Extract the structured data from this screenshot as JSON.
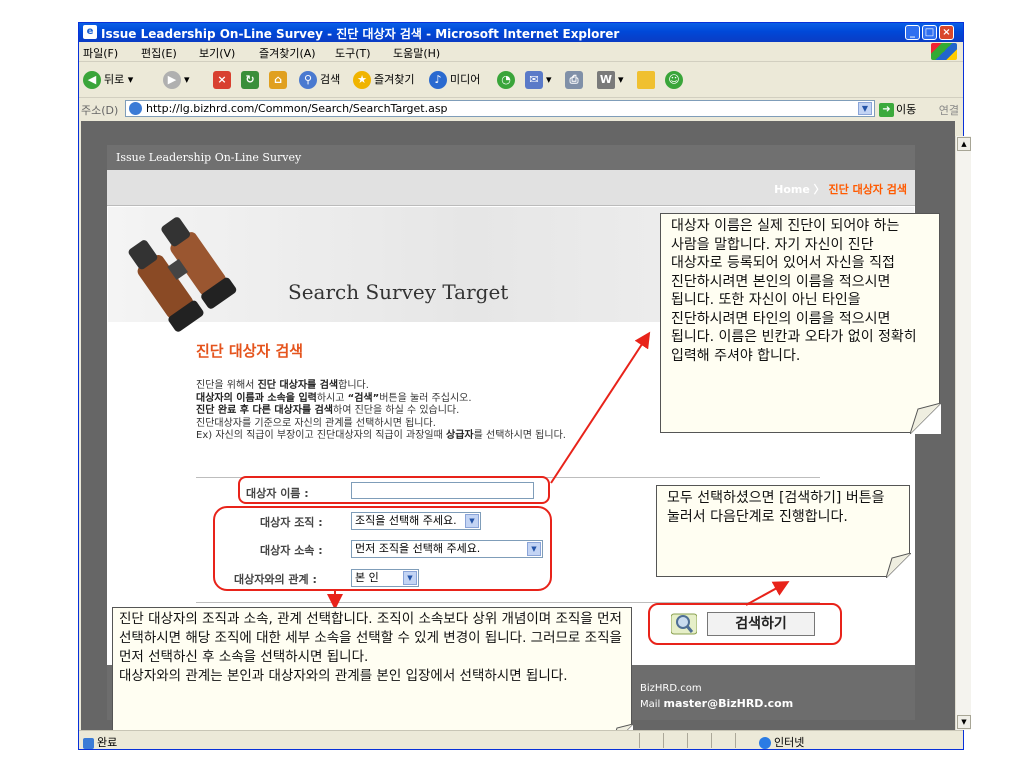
{
  "window": {
    "title": "Issue Leadership On-Line Survey - 진단 대상자 검색 - Microsoft Internet Explorer",
    "controls": {
      "minimize": "_",
      "maximize": "□",
      "close": "×"
    }
  },
  "menu": [
    "파일(F)",
    "편집(E)",
    "보기(V)",
    "즐겨찾기(A)",
    "도구(T)",
    "도움말(H)"
  ],
  "toolbar": {
    "back": "뒤로",
    "search": "검색",
    "favorites": "즐겨찾기",
    "media": "미디어"
  },
  "address": {
    "label": "주소(D)",
    "url": "http://lg.bizhrd.com/Common/Search/SearchTarget.asp",
    "go": "이동",
    "links": "연결"
  },
  "site": {
    "header": "Issue Leadership On-Line Survey",
    "breadcrumb_home": "Home",
    "breadcrumb_sep": "〉",
    "breadcrumb_current": "진단 대상자 검색",
    "banner_title": "Search Survey Target"
  },
  "section": {
    "title": "진단 대상자 검색",
    "instructions": [
      [
        "진단을 위해서 ",
        "진단 대상자를 검색",
        "합니다."
      ],
      [
        "",
        "대상자의 이름과 소속을 입력",
        "하시고 ",
        "“검색”",
        "버튼을 눌러 주십시오."
      ],
      [
        "",
        "진단 완료 후 다른 대상자를 검색",
        "하여 진단을 하실 수 있습니다."
      ],
      [
        "진단대상자를 기준으로 자신의 관계를 선택하시면 됩니다."
      ],
      [
        "Ex) 자신의 직급이 부장이고 진단대상자의 직급이 과장일때 ",
        "상급자",
        "를 선택하시면 됩니다."
      ]
    ]
  },
  "form": {
    "name_label": "대상자 이름 :",
    "name_value": "",
    "org_label": "대상자 조직 :",
    "org_selected": "조직을 선택해 주세요.",
    "dept_label": "대상자 소속 :",
    "dept_selected": "먼저 조직을 선택해 주세요.",
    "relation_label": "대상자와의 관계 :",
    "relation_selected": "본 인",
    "search_button": "검색하기"
  },
  "footer": {
    "line1": "BizHRD.com",
    "line2_prefix": "Mail ",
    "line2_email": "master@BizHRD.com"
  },
  "annotations": {
    "name_note": "대상자 이름은 실제 진단이 되어야 하는 사람을 말합니다. 자기 자신이 진단 대상자로 등록되어 있어서 자신을 직접 진단하시려면 본인의 이름을 적으시면 됩니다. 또한 자신이 아닌 타인을 진단하시려면 타인의 이름을 적으시면 됩니다. 이름은 빈칸과 오타가 없이 정확히 입력해 주셔야 합니다.",
    "search_note": "모두 선택하셨으면 [검색하기] 버튼을 눌러서 다음단계로 진행합니다.",
    "org_note": "진단 대상자의 조직과 소속, 관계 선택합니다. 조직이 소속보다 상위 개념이며 조직을 먼저 선택하시면 해당 조직에 대한 세부 소속을 선택할 수 있게 변경이 됩니다. 그러므로 조직을 먼저 선택하신 후 소속을 선택하시면 됩니다.\n대상자와의 관계는 본인과 대상자와의 관계를 본인 입장에서 선택하시면 됩니다."
  },
  "status": {
    "text": "완료",
    "zone": "인터넷"
  },
  "colors": {
    "accent_orange": "#e5541d",
    "annotation_red": "#e8231a",
    "xp_title_blue": "#0a5fe6"
  }
}
